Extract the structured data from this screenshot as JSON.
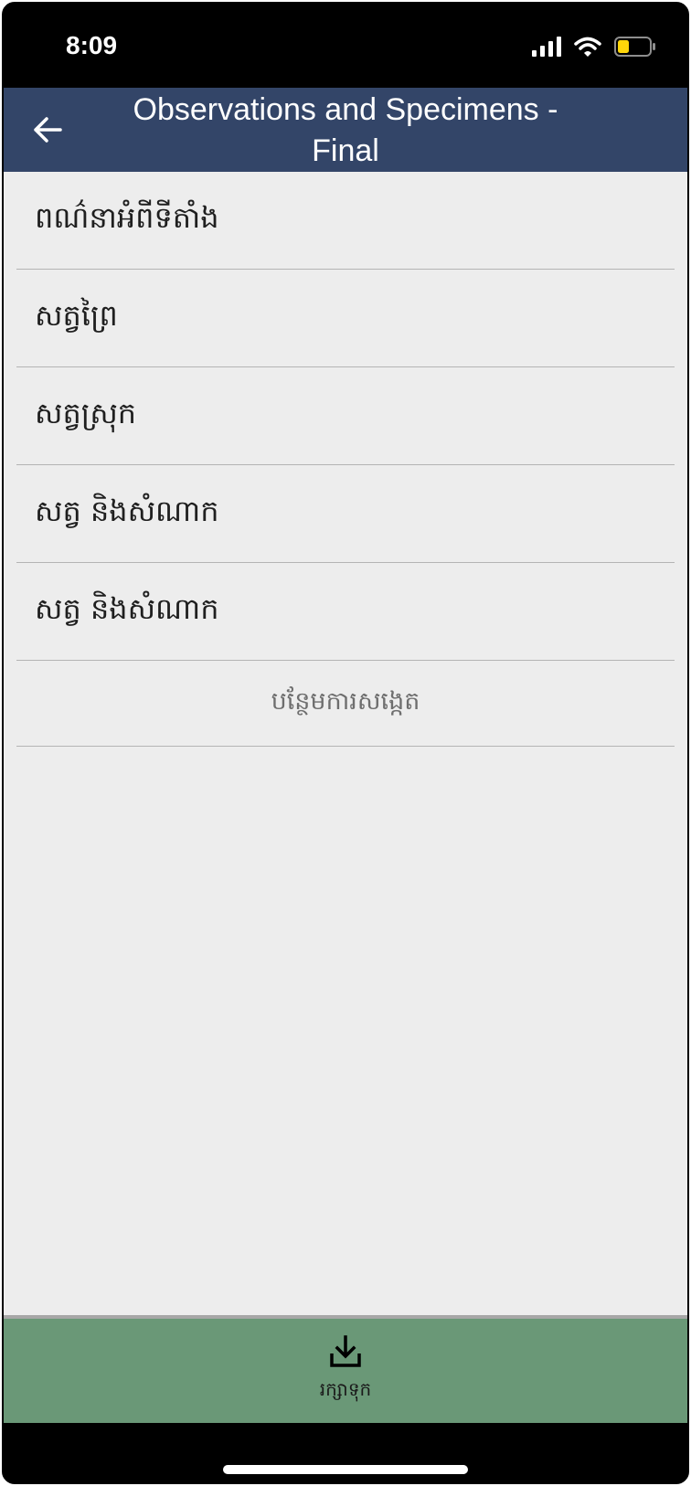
{
  "status_bar": {
    "time": "8:09"
  },
  "header": {
    "title": "Observations and Specimens - Final",
    "back_icon": "arrow-left-icon"
  },
  "list": {
    "items": [
      {
        "label": "ពណ៌នាអំពីទីតាំង"
      },
      {
        "label": "សត្វព្រៃ"
      },
      {
        "label": "សត្វស្រុក"
      },
      {
        "label": "សត្វ និងសំណាក"
      },
      {
        "label": "សត្វ និងសំណាក"
      }
    ],
    "add_label": "បន្ថែមការសង្កេត"
  },
  "bottom_bar": {
    "save_label": "រក្សាទុក",
    "save_icon": "download-icon"
  },
  "colors": {
    "header_bg": "#334568",
    "content_bg": "#ededed",
    "bottom_bar_bg": "#6a9877",
    "battery_fill": "#ffd60a"
  }
}
